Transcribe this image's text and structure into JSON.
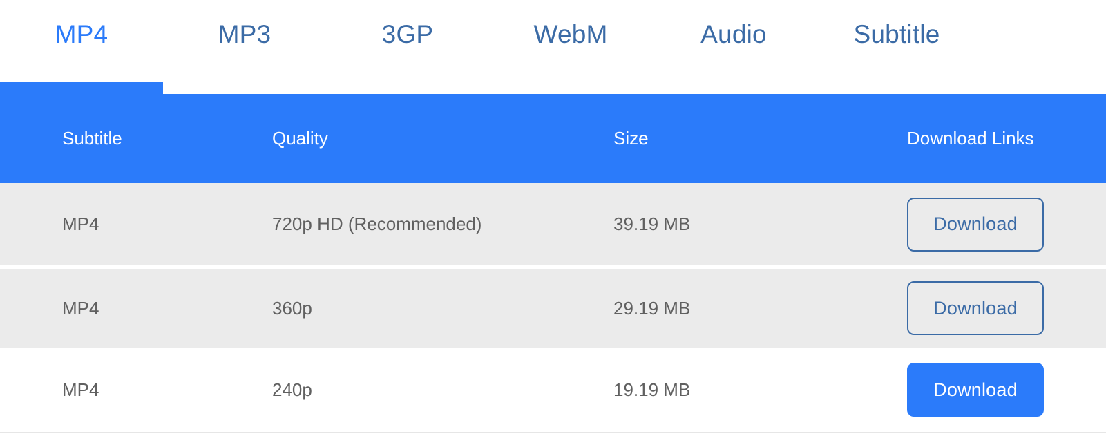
{
  "colors": {
    "accent_blue": "#2b7bfa",
    "muted_blue": "#3b6ba6",
    "row_shaded": "#ebebeb",
    "row_plain": "#ffffff",
    "cell_text": "#606060",
    "bottom_border": "#e6e6e6"
  },
  "tabs": [
    {
      "label": "MP4",
      "active": true
    },
    {
      "label": "MP3",
      "active": false
    },
    {
      "label": "3GP",
      "active": false
    },
    {
      "label": "WebM",
      "active": false
    },
    {
      "label": "Audio",
      "active": false
    },
    {
      "label": "Subtitle",
      "active": false
    }
  ],
  "table": {
    "headers": {
      "subtitle": "Subtitle",
      "quality": "Quality",
      "size": "Size",
      "links": "Download Links"
    },
    "rows": [
      {
        "subtitle": "MP4",
        "quality": "720p HD (Recommended)",
        "size": "39.19 MB",
        "download_label": "Download",
        "button_style": "outline",
        "shaded": true
      },
      {
        "subtitle": "MP4",
        "quality": "360p",
        "size": "29.19 MB",
        "download_label": "Download",
        "button_style": "outline",
        "shaded": true
      },
      {
        "subtitle": "MP4",
        "quality": "240p",
        "size": "19.19 MB",
        "download_label": "Download",
        "button_style": "filled",
        "shaded": false
      }
    ]
  }
}
